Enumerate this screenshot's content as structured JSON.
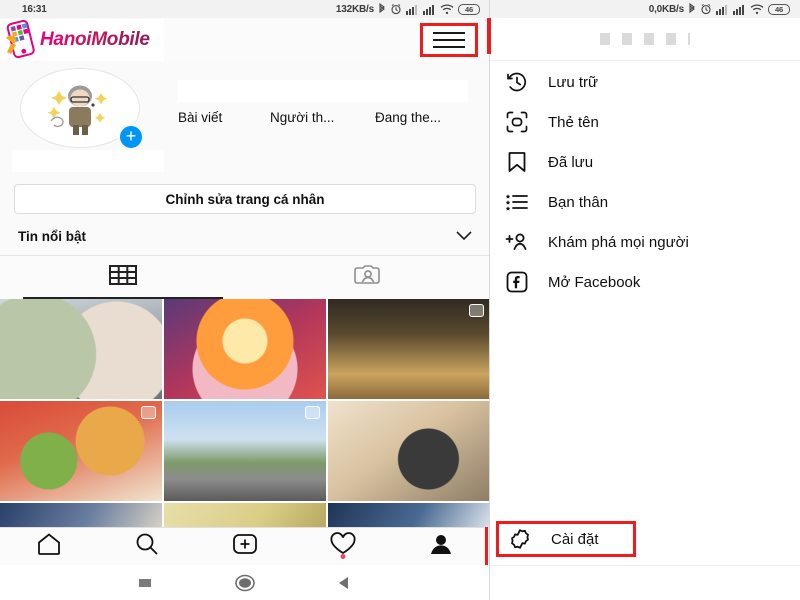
{
  "left_screen": {
    "status_bar": {
      "time": "16:31",
      "network_speed": "132KB/s",
      "battery": "46"
    },
    "app_header": {
      "watermark_text": "HanoiMobile",
      "menu_icon": "hamburger-menu-icon"
    },
    "profile": {
      "avatar_alt": "profile-avatar",
      "add_story_label": "+",
      "username_redacted": "",
      "stats_redacted": "",
      "stats": [
        {
          "label": "Bài viết"
        },
        {
          "label": "Người th..."
        },
        {
          "label": "Đang the..."
        }
      ],
      "edit_button": "Chỉnh sửa trang cá nhân",
      "highlights_label": "Tin nổi bật",
      "highlights_chevron": "chevron-down-icon"
    },
    "tabs": [
      {
        "name": "grid-tab",
        "icon": "grid-icon",
        "active": true
      },
      {
        "name": "tagged-tab",
        "icon": "tagged-person-icon",
        "active": false
      }
    ],
    "grid_cells": [
      {
        "name": "post-milk-tea",
        "multi": false
      },
      {
        "name": "post-dessert",
        "multi": false
      },
      {
        "name": "post-guitar-cafe",
        "multi": true
      },
      {
        "name": "post-rice-bowls",
        "multi": true
      },
      {
        "name": "post-street-view",
        "multi": true
      },
      {
        "name": "post-table-decor",
        "multi": false
      },
      {
        "name": "post-row3-a",
        "multi": false
      },
      {
        "name": "post-row3-b",
        "multi": false
      },
      {
        "name": "post-row3-c",
        "multi": false
      }
    ],
    "bottom_nav": [
      {
        "name": "home-icon",
        "badge": false
      },
      {
        "name": "search-icon",
        "badge": false
      },
      {
        "name": "add-post-icon",
        "badge": false
      },
      {
        "name": "heart-activity-icon",
        "badge": true
      },
      {
        "name": "profile-icon",
        "badge": false
      }
    ],
    "system_nav": [
      {
        "name": "recents-square-icon"
      },
      {
        "name": "home-circle-icon"
      },
      {
        "name": "back-triangle-icon"
      }
    ]
  },
  "right_screen": {
    "status_bar": {
      "network_speed": "0,0KB/s",
      "battery": "46"
    },
    "menu_items": [
      {
        "label": "Lưu trữ",
        "icon": "archive-clock-icon"
      },
      {
        "label": "Thẻ tên",
        "icon": "nametag-scan-icon"
      },
      {
        "label": "Đã lưu",
        "icon": "bookmark-icon"
      },
      {
        "label": "Bạn thân",
        "icon": "close-friends-list-icon"
      },
      {
        "label": "Khám phá mọi người",
        "icon": "discover-people-icon"
      },
      {
        "label": "Mở Facebook",
        "icon": "facebook-icon"
      }
    ],
    "settings_item": {
      "label": "Cài đặt",
      "icon": "settings-gear-icon",
      "highlighted": true
    },
    "system_nav": [
      {
        "name": "home-circle-icon"
      },
      {
        "name": "back-triangle-icon"
      }
    ]
  },
  "colors": {
    "highlight_red": "#ee1c1c",
    "instagram_blue": "#0095f6",
    "notification_red": "#ed4956",
    "brand_pink": "#e8007d"
  }
}
